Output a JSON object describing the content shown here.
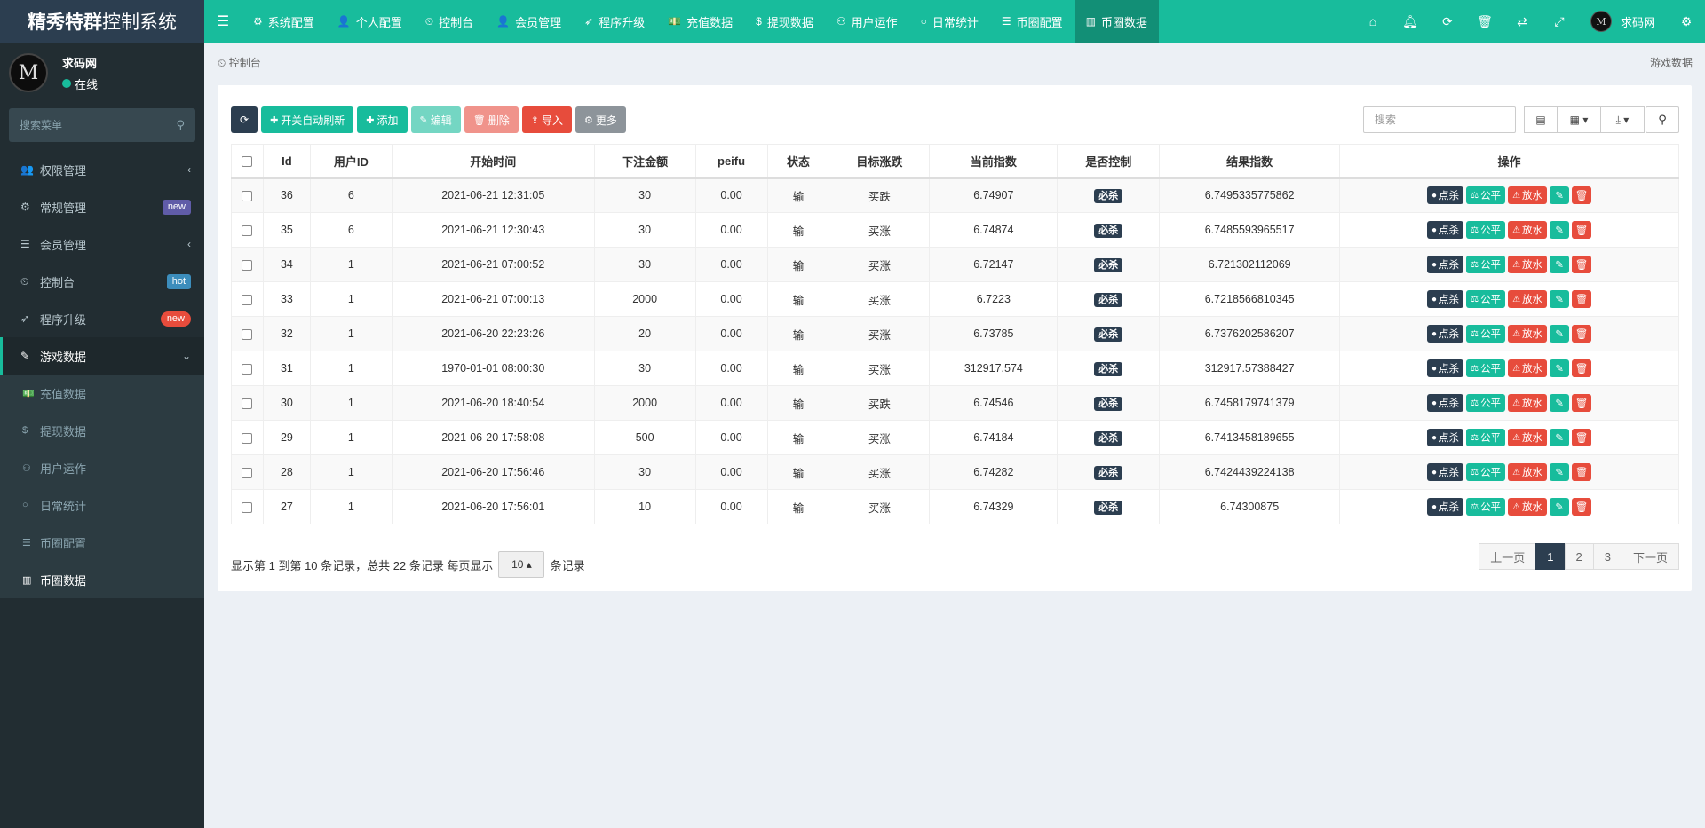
{
  "brand": {
    "bold": "精秀特群",
    "rest": "控制系统"
  },
  "topnav": {
    "items": [
      {
        "icon": "⚙",
        "label": "系统配置"
      },
      {
        "icon": "👤",
        "label": "个人配置"
      },
      {
        "icon": "⏲",
        "label": "控制台"
      },
      {
        "icon": "👤",
        "label": "会员管理"
      },
      {
        "icon": "➶",
        "label": "程序升级"
      },
      {
        "icon": "💵",
        "label": "充值数据"
      },
      {
        "icon": "$",
        "label": "提现数据"
      },
      {
        "icon": "⚇",
        "label": "用户运作"
      },
      {
        "icon": "○",
        "label": "日常统计"
      },
      {
        "icon": "☰",
        "label": "币圈配置"
      },
      {
        "icon": "▥",
        "label": "币圈数据"
      }
    ],
    "user": "求码网"
  },
  "sidebar": {
    "username": "求码网",
    "status": "在线",
    "search_placeholder": "搜索菜单",
    "items": [
      {
        "icon": "👥",
        "label": "权限管理",
        "arrow": "‹"
      },
      {
        "icon": "⚙",
        "label": "常规管理",
        "badge": "new"
      },
      {
        "icon": "☰",
        "label": "会员管理",
        "arrow": "‹"
      },
      {
        "icon": "⏲",
        "label": "控制台",
        "badge": "hot"
      },
      {
        "icon": "➶",
        "label": "程序升级",
        "badge": "new"
      },
      {
        "icon": "✎",
        "label": "游戏数据",
        "arrow": "⌄"
      }
    ],
    "subitems": [
      {
        "icon": "💵",
        "label": "充值数据"
      },
      {
        "icon": "$",
        "label": "提现数据"
      },
      {
        "icon": "⚇",
        "label": "用户运作"
      },
      {
        "icon": "○",
        "label": "日常统计"
      },
      {
        "icon": "☰",
        "label": "币圈配置"
      },
      {
        "icon": "▥",
        "label": "币圈数据"
      }
    ]
  },
  "breadcrumb": {
    "icon": "⏲",
    "label": "控制台",
    "right": "游戏数据"
  },
  "toolbar": {
    "refresh_icon": "⟳",
    "auto_refresh": "开关自动刷新",
    "add": "添加",
    "edit": "编辑",
    "delete": "删除",
    "import": "导入",
    "more": "更多",
    "search_placeholder": "搜索"
  },
  "table": {
    "headers": [
      "Id",
      "用户ID",
      "开始时间",
      "下注金额",
      "peifu",
      "状态",
      "目标涨跌",
      "当前指数",
      "是否控制",
      "结果指数",
      "操作"
    ],
    "rows": [
      [
        "36",
        "6",
        "2021-06-21 12:31:05",
        "30",
        "0.00",
        "输",
        "买跌",
        "6.74907",
        "必杀",
        "6.7495335775862"
      ],
      [
        "35",
        "6",
        "2021-06-21 12:30:43",
        "30",
        "0.00",
        "输",
        "买涨",
        "6.74874",
        "必杀",
        "6.7485593965517"
      ],
      [
        "34",
        "1",
        "2021-06-21 07:00:52",
        "30",
        "0.00",
        "输",
        "买涨",
        "6.72147",
        "必杀",
        "6.721302112069"
      ],
      [
        "33",
        "1",
        "2021-06-21 07:00:13",
        "2000",
        "0.00",
        "输",
        "买涨",
        "6.7223",
        "必杀",
        "6.7218566810345"
      ],
      [
        "32",
        "1",
        "2021-06-20 22:23:26",
        "20",
        "0.00",
        "输",
        "买涨",
        "6.73785",
        "必杀",
        "6.7376202586207"
      ],
      [
        "31",
        "1",
        "1970-01-01 08:00:30",
        "30",
        "0.00",
        "输",
        "买涨",
        "312917.574",
        "必杀",
        "312917.57388427"
      ],
      [
        "30",
        "1",
        "2021-06-20 18:40:54",
        "2000",
        "0.00",
        "输",
        "买跌",
        "6.74546",
        "必杀",
        "6.7458179741379"
      ],
      [
        "29",
        "1",
        "2021-06-20 17:58:08",
        "500",
        "0.00",
        "输",
        "买涨",
        "6.74184",
        "必杀",
        "6.7413458189655"
      ],
      [
        "28",
        "1",
        "2021-06-20 17:56:46",
        "30",
        "0.00",
        "输",
        "买涨",
        "6.74282",
        "必杀",
        "6.7424439224138"
      ],
      [
        "27",
        "1",
        "2021-06-20 17:56:01",
        "10",
        "0.00",
        "输",
        "买涨",
        "6.74329",
        "必杀",
        "6.74300875"
      ]
    ],
    "ops": {
      "kill": "点杀",
      "fair": "公平",
      "release": "放水"
    }
  },
  "footer": {
    "text_before": "显示第 1 到第 10 条记录，总共 22 条记录 每页显示",
    "page_size": "10",
    "text_after": "条记录"
  },
  "pager": {
    "prev": "上一页",
    "pages": [
      "1",
      "2",
      "3"
    ],
    "next": "下一页"
  }
}
